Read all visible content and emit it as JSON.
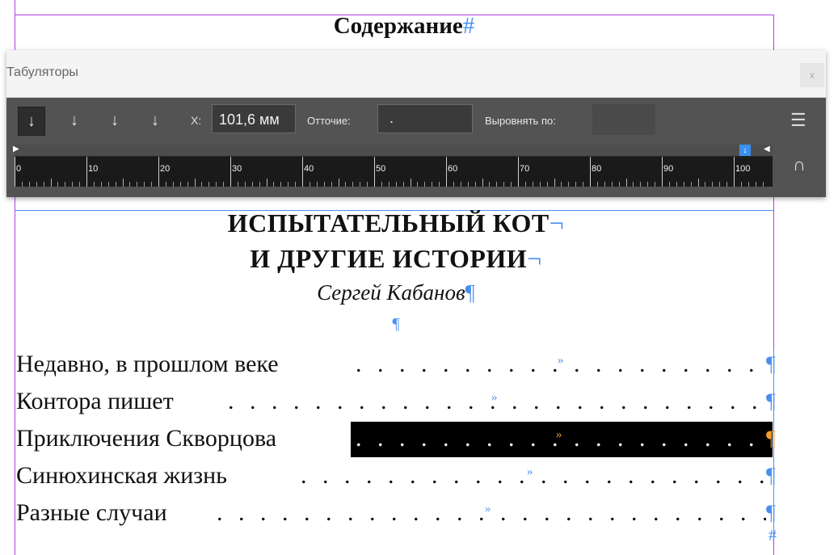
{
  "document": {
    "heading": "Содержание",
    "heading_mark": "#",
    "title_line1": "ИСПЫТАТЕЛЬНЫЙ КОТ",
    "title_line2": "И ДРУГИЕ ИСТОРИИ",
    "line_break_mark": "¬",
    "author": "Сергей Кабанов",
    "paragraph_mark": "¶",
    "tab_mark": "»",
    "dot_leader": ". . . . . . . . . . . . . . . . . . . . . . . . . . . . . . . . . . . . . . . . . . . . . . . . . . . . . . .",
    "end_mark": "#",
    "toc": [
      {
        "label": "Недавно, в прошлом веке",
        "selected": false
      },
      {
        "label": "Контора пишет",
        "selected": false
      },
      {
        "label": "Приключения Скворцова",
        "selected": true
      },
      {
        "label": "Синюхинская жизнь",
        "selected": false
      },
      {
        "label": "Разные случаи",
        "selected": false
      }
    ]
  },
  "tabs_panel": {
    "title": "Табуляторы",
    "close_label": "x",
    "x_label": "X:",
    "x_value": "101,6 мм",
    "leader_label": "Отточие:",
    "leader_value": ".",
    "align_label": "Выровнять по:",
    "align_value": "",
    "tab_types": [
      {
        "name": "left-justified-tab",
        "glyph": "↓",
        "active": true
      },
      {
        "name": "center-justified-tab",
        "glyph": "↓",
        "active": false
      },
      {
        "name": "right-justified-tab",
        "glyph": "↓",
        "active": false
      },
      {
        "name": "align-to-decimal-tab",
        "glyph": "↓",
        "active": false
      }
    ],
    "ruler_labels": [
      "0",
      "10",
      "20",
      "30",
      "40",
      "50",
      "60",
      "70",
      "80",
      "90",
      "100"
    ],
    "tab_stop_position_mm": 101.6,
    "menu_icon": "hamburger-icon",
    "magnet_icon": "magnet-icon"
  }
}
